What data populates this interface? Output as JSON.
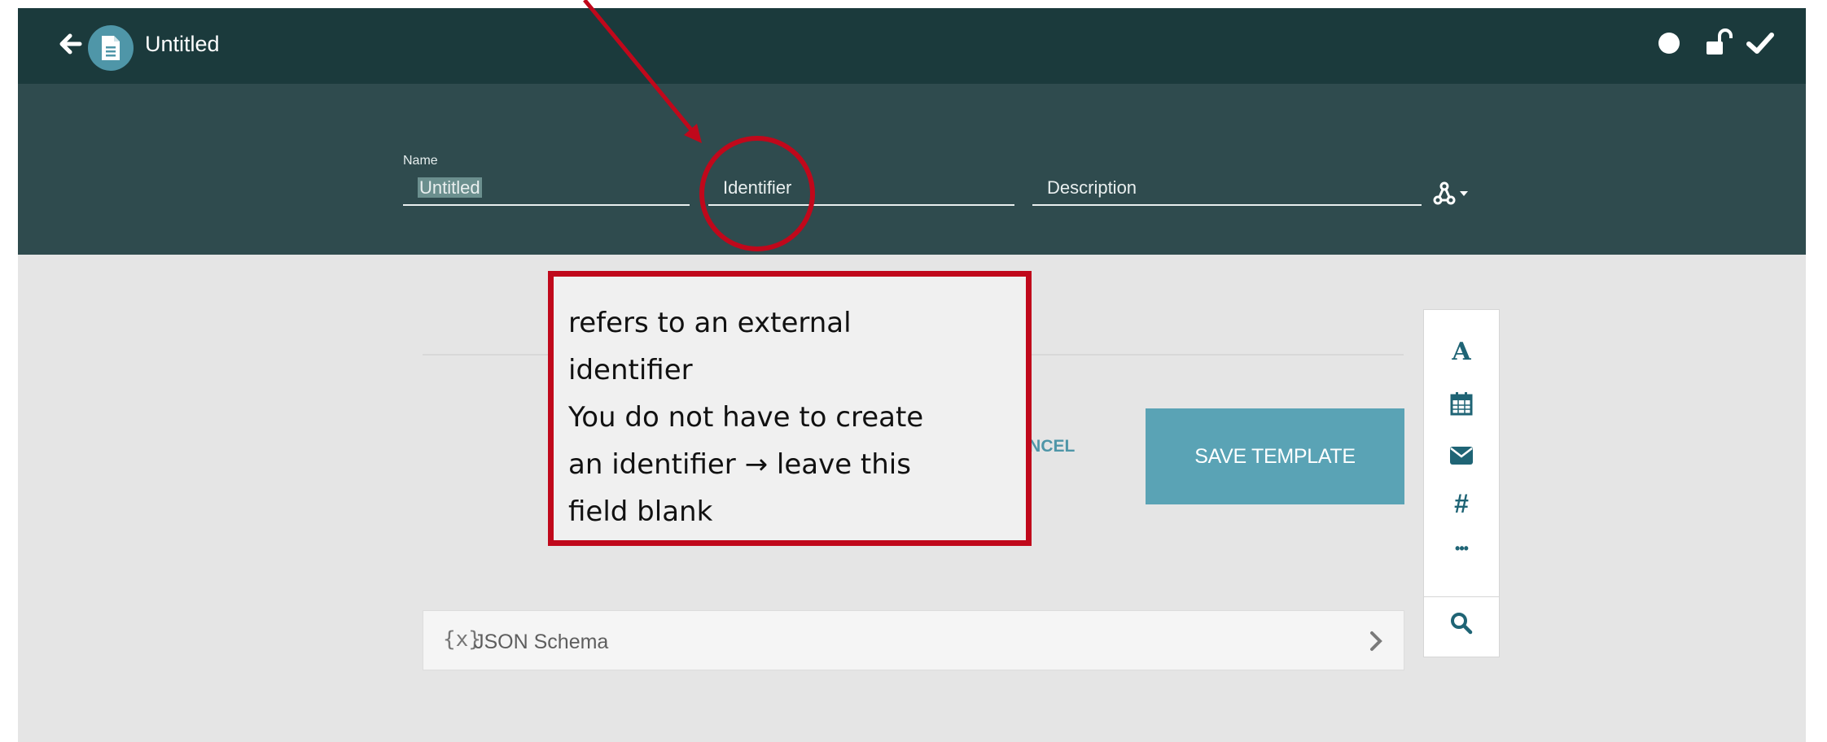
{
  "header": {
    "title": "Untitled",
    "back_icon": "arrow-left-icon",
    "doc_icon": "document-icon",
    "status_icons": [
      "circle-dot-icon",
      "unlock-icon",
      "checkmark-icon"
    ]
  },
  "form": {
    "name_label": "Name",
    "name_value": "Untitled",
    "identifier_placeholder": "Identifier",
    "description_placeholder": "Description",
    "share_icon": "share-nodes-icon"
  },
  "actions": {
    "cancel_label": "ANCEL",
    "save_label": "SAVE TEMPLATE"
  },
  "toolbox": {
    "items": [
      "text-icon",
      "calendar-icon",
      "envelope-icon",
      "hash-icon",
      "more-icon",
      "search-icon"
    ],
    "text_glyph": "A",
    "hash_glyph": "#",
    "more_glyph": "•••"
  },
  "schema": {
    "icon_glyph": "{x}",
    "label": "JSON Schema"
  },
  "annotation": {
    "text": "refers to an external\nidentifier\nYou do not have to create\nan identifier → leave this\nfield blank",
    "color": "#c0081b"
  },
  "colors": {
    "topbar": "#1b3a3c",
    "header_panel": "#2f4b4e",
    "accent": "#5aa3b5",
    "canvas": "#e5e5e5"
  }
}
